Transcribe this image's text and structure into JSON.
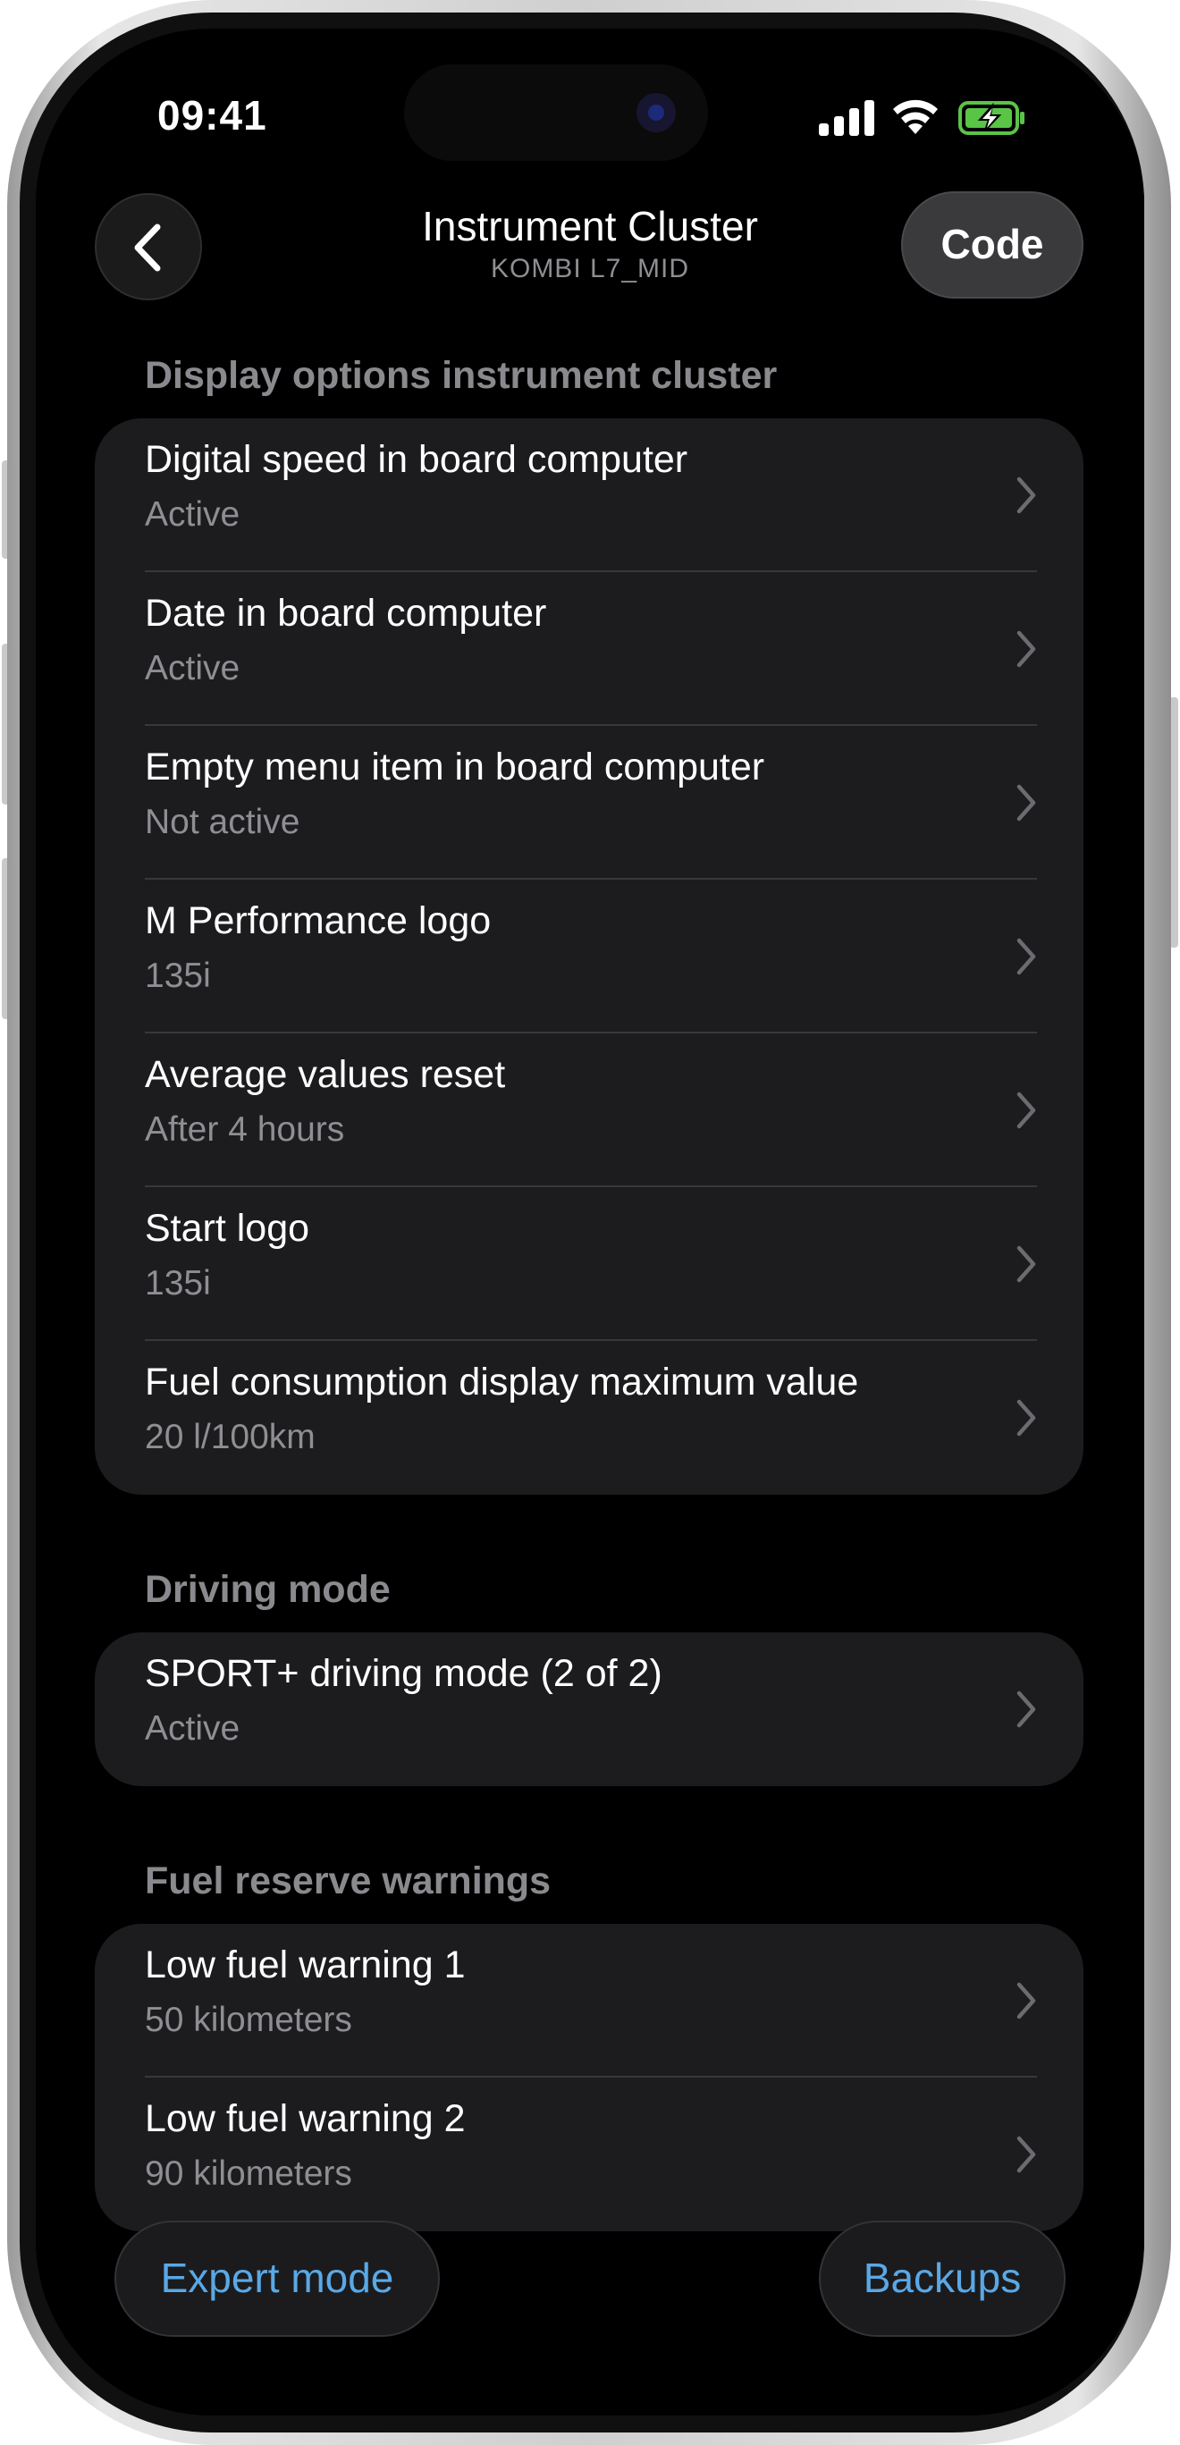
{
  "status_bar": {
    "time": "09:41"
  },
  "nav": {
    "title": "Instrument Cluster",
    "subtitle": "KOMBI L7_MID",
    "code_label": "Code"
  },
  "sections": [
    {
      "header": "Display options instrument cluster",
      "rows": [
        {
          "label": "Digital speed in board computer",
          "value": "Active"
        },
        {
          "label": "Date in board computer",
          "value": "Active"
        },
        {
          "label": "Empty menu item in board computer",
          "value": "Not active"
        },
        {
          "label": "M Performance logo",
          "value": "135i"
        },
        {
          "label": "Average values reset",
          "value": "After 4 hours"
        },
        {
          "label": "Start logo",
          "value": "135i"
        },
        {
          "label": "Fuel consumption display maximum value",
          "value": "20 l/100km"
        }
      ]
    },
    {
      "header": "Driving mode",
      "rows": [
        {
          "label": "SPORT+ driving mode (2 of 2)",
          "value": "Active"
        }
      ]
    },
    {
      "header": "Fuel reserve warnings",
      "rows": [
        {
          "label": "Low fuel warning 1",
          "value": "50 kilometers"
        },
        {
          "label": "Low fuel warning 2",
          "value": "90 kilometers"
        }
      ]
    }
  ],
  "bottom_bar": {
    "expert_mode_label": "Expert mode",
    "backups_label": "Backups"
  },
  "colors": {
    "accent": "#5aa8e6",
    "battery_green": "#5ac447",
    "card_bg": "#1c1c1e",
    "secondary_text": "#8e8e93"
  }
}
